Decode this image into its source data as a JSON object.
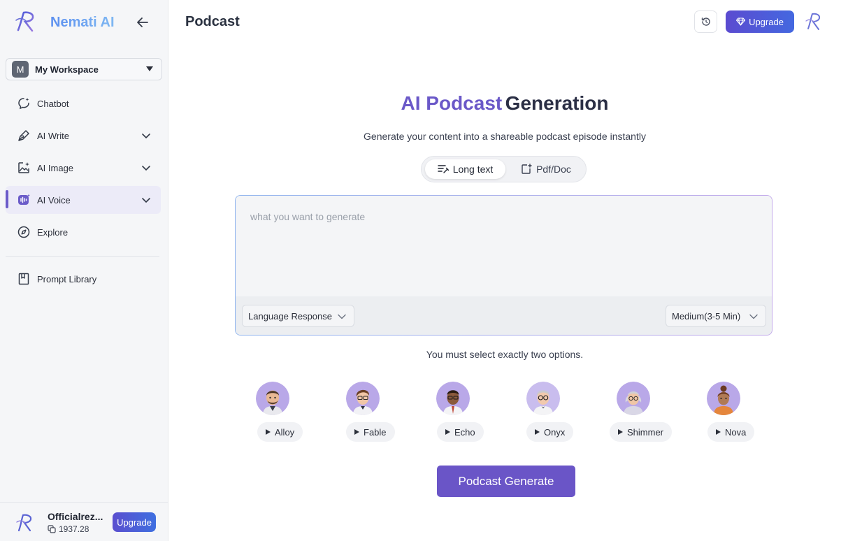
{
  "sidebar": {
    "brand_name": "Nemati AI",
    "workspace": {
      "initial": "M",
      "name": "My Workspace"
    },
    "items": [
      {
        "label": "Chatbot",
        "icon": "chat-sparkle-icon",
        "has_chevron": false,
        "active": false
      },
      {
        "label": "AI Write",
        "icon": "pen-icon",
        "has_chevron": true,
        "active": false
      },
      {
        "label": "AI Image",
        "icon": "image-sparkle-icon",
        "has_chevron": true,
        "active": false
      },
      {
        "label": "AI Voice",
        "icon": "voice-wave-icon",
        "has_chevron": true,
        "active": true
      },
      {
        "label": "Explore",
        "icon": "compass-icon",
        "has_chevron": false,
        "active": false
      }
    ],
    "prompt_library": {
      "label": "Prompt Library",
      "icon": "bookmark-book-icon"
    },
    "user": {
      "name": "Officialrez...",
      "credits": "1937.28",
      "upgrade_label": "Upgrade"
    }
  },
  "header": {
    "title": "Podcast",
    "upgrade_label": "Upgrade"
  },
  "main": {
    "hero_title_accent": "AI Podcast",
    "hero_title_rest": "Generation",
    "subtitle": "Generate your content into a shareable podcast episode instantly",
    "modes": [
      {
        "label": "Long text",
        "icon": "text-lines-icon",
        "active": true
      },
      {
        "label": "Pdf/Doc",
        "icon": "doc-add-icon",
        "active": false
      }
    ],
    "input_placeholder": "what you want to generate",
    "language_select": "Language Response",
    "length_select": "Medium(3-5 Min)",
    "hint": "You must select exactly two options.",
    "voices": [
      {
        "name": "Alloy"
      },
      {
        "name": "Fable"
      },
      {
        "name": "Echo"
      },
      {
        "name": "Onyx"
      },
      {
        "name": "Shimmer"
      },
      {
        "name": "Nova"
      }
    ],
    "generate_label": "Podcast Generate"
  },
  "colors": {
    "accent": "#6a55c7",
    "upgrade_gradient_start": "#5b4bd0",
    "upgrade_gradient_end": "#4468e0",
    "active_nav_bg": "#ecebf8"
  }
}
